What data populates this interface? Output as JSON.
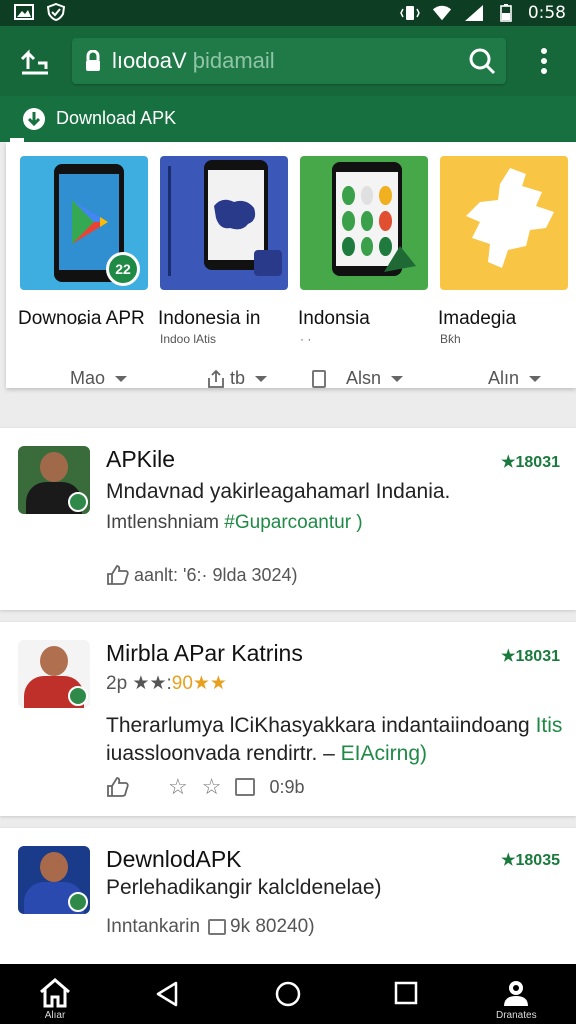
{
  "status": {
    "time": "0:58"
  },
  "appbar": {
    "query_text": "lıodoaV",
    "query_placeholder": "þidamail",
    "download_label": "Download APK"
  },
  "carousel": [
    {
      "title": "Downoɕia APR",
      "sub": "",
      "action": "Mao"
    },
    {
      "title": "Indonesia in",
      "sub": "Indoo lAtis",
      "action": "tb"
    },
    {
      "title": "Indonsia",
      "sub": "· ·",
      "action": "Alsn"
    },
    {
      "title": "Imadegia",
      "sub": "Bƙh",
      "action": "Alın"
    }
  ],
  "apps": [
    {
      "title": "APKile",
      "rating": "★18031",
      "line1": "Mndavnad yakirleagahamarl Indania.",
      "line2_a": "Imtlenshniam ",
      "line2_b": "#Guparсoantur )",
      "meta": "aanlt: '6:·  9lda 3024)"
    },
    {
      "title": "Mirbla APar Katrins",
      "rating": "★18031",
      "line1_a": "2p ★★:",
      "line1_b": "90★★",
      "line2_a": "Therarlumya lCiKhasyakkara indantaiindoang ",
      "line2_b": "Itis",
      "line3_a": "iuassloonvada rendirtr. – ",
      "line3_b": "EIAcirng)",
      "meta": "0:9b"
    },
    {
      "title": "DewnlodAPK",
      "rating": "★18035",
      "line1": "Perlehadikangir  kalcldenelae)",
      "meta_a": "Inntankarin",
      "meta_b": "9k 80240)"
    }
  ],
  "nav": {
    "home_label": "Alıar",
    "profile_label": "Dranates"
  }
}
